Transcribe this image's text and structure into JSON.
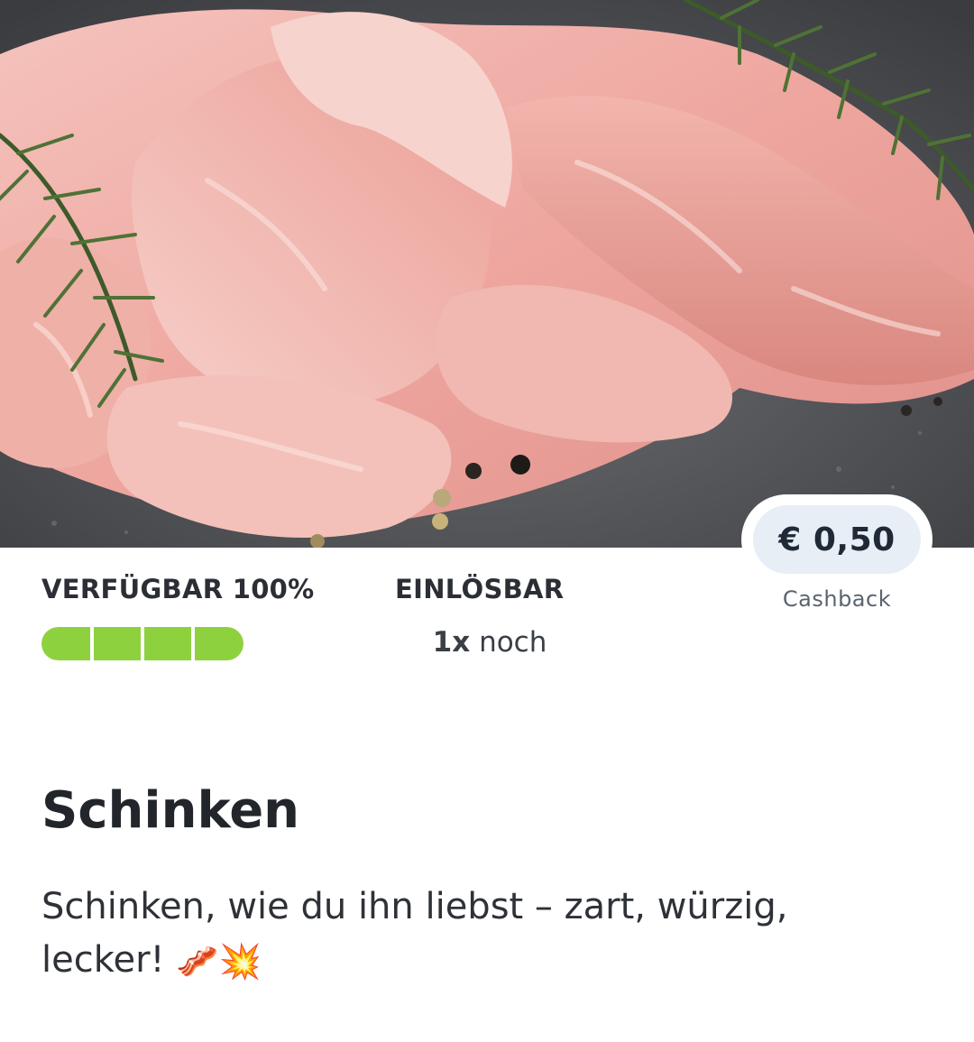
{
  "hero": {
    "image": "sliced-ham-with-rosemary-photo"
  },
  "cashback": {
    "amount": "€ 0,50",
    "label": "Cashback"
  },
  "availability": {
    "heading": "VERFÜGBAR 100%",
    "level": 1.0,
    "segments": 4
  },
  "redeem": {
    "heading": "EINLÖSBAR",
    "count": "1x",
    "suffix": "noch"
  },
  "product": {
    "title": "Schinken",
    "description": "Schinken, wie du ihn liebst – zart, würzig, lecker!",
    "emojis": "🥓💥"
  },
  "colors": {
    "accent_green": "#8ed13f",
    "pill_background": "#e8eef6"
  }
}
